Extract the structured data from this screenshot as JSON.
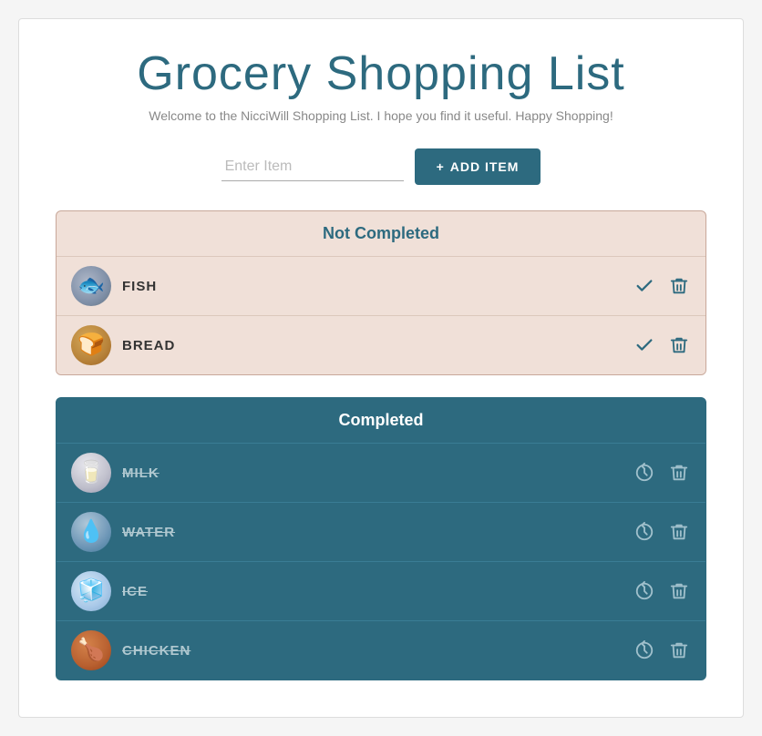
{
  "app": {
    "title": "Grocery Shopping List",
    "subtitle": "Welcome to the NicciWill Shopping List. I hope you find it useful. Happy Shopping!",
    "input_placeholder": "Enter Item",
    "add_button_label": "ADD ITEM",
    "add_button_icon": "+"
  },
  "not_completed": {
    "header": "Not Completed",
    "items": [
      {
        "id": "fish",
        "name": "FISH",
        "avatar_type": "fish",
        "emoji": "🐟"
      },
      {
        "id": "bread",
        "name": "BREAD",
        "avatar_type": "bread",
        "emoji": "🍞"
      }
    ]
  },
  "completed": {
    "header": "Completed",
    "items": [
      {
        "id": "milk",
        "name": "MILK",
        "avatar_type": "milk",
        "emoji": "🥛"
      },
      {
        "id": "water",
        "name": "WATER",
        "avatar_type": "water",
        "emoji": "💧"
      },
      {
        "id": "ice",
        "name": "ICE",
        "avatar_type": "ice",
        "emoji": "🧊"
      },
      {
        "id": "chicken",
        "name": "CHICKEN",
        "avatar_type": "chicken",
        "emoji": "🍗"
      }
    ]
  },
  "colors": {
    "primary": "#2d6a7f",
    "not_completed_bg": "#f0e0d8",
    "not_completed_border": "#c8a89a"
  }
}
